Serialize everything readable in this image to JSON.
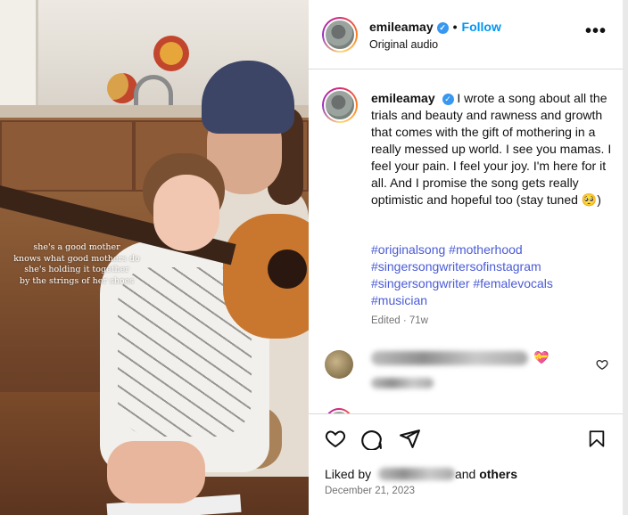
{
  "media": {
    "caption_lines": [
      "she's a good mother",
      "knows what good mothers do",
      "she's holding it together",
      "by the strings of her shoes"
    ]
  },
  "header": {
    "username": "emileamay",
    "follow_label": "Follow",
    "separator": "•",
    "audio_label": "Original audio",
    "more_label": "•••",
    "verified_glyph": "✓"
  },
  "post": {
    "username": "emileamay",
    "caption": "I wrote a song about all the trials and beauty and rawness and growth that comes with the gift of mothering in a really messed up world. I see you mamas. I feel your pain. I feel your joy. I'm here for it all. And I promise the song gets really optimistic and hopeful too (stay tuned 🥺)",
    "hashtags": [
      "#originalsong #motherhood",
      "#singersongwritersofinstagram",
      "#singersongwriter #femalevocals",
      "#musician"
    ],
    "edited_label": "Edited",
    "edited_time": "71w",
    "edited_separator": "·"
  },
  "comment": {
    "emoji": "💝"
  },
  "footer": {
    "liked_prefix": "Liked by",
    "liked_suffix_and": "and",
    "liked_suffix_others": "others",
    "date": "December 21, 2023"
  },
  "icons": {
    "like": "heart-icon",
    "comment": "comment-icon",
    "share": "share-icon",
    "save": "bookmark-icon",
    "comment_like": "heart-small-icon"
  },
  "colors": {
    "accent": "#0095f6",
    "hashtag": "#4a5bd6",
    "muted": "#737373",
    "verified": "#3897f0"
  }
}
